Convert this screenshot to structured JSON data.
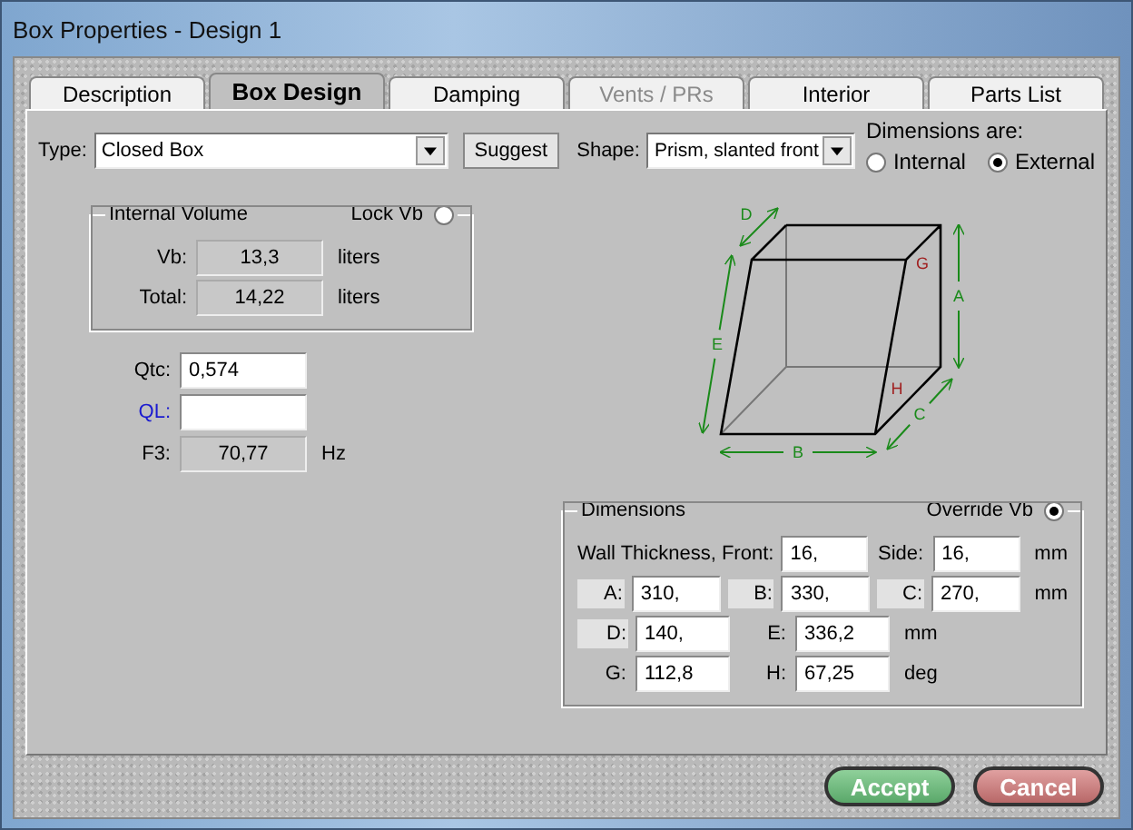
{
  "window": {
    "title": "Box Properties - Design 1"
  },
  "tabs": [
    {
      "label": "Description",
      "selected": false,
      "disabled": false
    },
    {
      "label": "Box Design",
      "selected": true,
      "disabled": false
    },
    {
      "label": "Damping",
      "selected": false,
      "disabled": false
    },
    {
      "label": "Vents / PRs",
      "selected": false,
      "disabled": true
    },
    {
      "label": "Interior",
      "selected": false,
      "disabled": false
    },
    {
      "label": "Parts List",
      "selected": false,
      "disabled": false
    }
  ],
  "type": {
    "label": "Type:",
    "value": "Closed Box"
  },
  "suggest_button": "Suggest",
  "shape": {
    "label": "Shape:",
    "value": "Prism, slanted front"
  },
  "dimensions_are": {
    "label": "Dimensions are:",
    "options": [
      {
        "label": "Internal",
        "selected": false
      },
      {
        "label": "External",
        "selected": true
      }
    ]
  },
  "internal_volume": {
    "title": "Internal Volume",
    "lock": {
      "label": "Lock Vb",
      "checked": false
    },
    "rows": [
      {
        "label": "Vb:",
        "value": "13,3",
        "unit": "liters"
      },
      {
        "label": "Total:",
        "value": "14,22",
        "unit": "liters"
      }
    ]
  },
  "response": [
    {
      "label": "Qtc:",
      "value": "0,574",
      "editable": true,
      "color": "#000000"
    },
    {
      "label": "QL:",
      "editable": true,
      "color": "#1a1ad0"
    },
    {
      "label": "F3:",
      "value": "70,77",
      "unit": "Hz",
      "editable": false,
      "color": "#000000"
    }
  ],
  "diagram": {
    "labels": [
      {
        "text": "D",
        "kind": "length"
      },
      {
        "text": "E",
        "kind": "length"
      },
      {
        "text": "A",
        "kind": "length"
      },
      {
        "text": "G",
        "kind": "angle"
      },
      {
        "text": "H",
        "kind": "angle"
      },
      {
        "text": "C",
        "kind": "length"
      },
      {
        "text": "B",
        "kind": "length"
      }
    ]
  },
  "dimensions": {
    "title": "Dimensions",
    "override": {
      "label": "Override Vb",
      "checked": true
    },
    "wall": {
      "label": "Wall Thickness, Front:",
      "front": "16,",
      "side_label": "Side:",
      "side": "16,",
      "unit": "mm"
    },
    "rows": [
      {
        "cells": [
          {
            "label": "A:",
            "value": "310,",
            "highlighted": true
          },
          {
            "label": "B:",
            "value": "330,",
            "highlighted": true
          },
          {
            "label": "C:",
            "value": "270,",
            "highlighted": true
          }
        ],
        "unit": "mm"
      },
      {
        "cells": [
          {
            "label": "D:",
            "value": "140,",
            "highlighted": true
          },
          {
            "label": "E:",
            "value": "336,2",
            "highlighted": false
          }
        ],
        "unit": "mm"
      },
      {
        "cells": [
          {
            "label": "G:",
            "value": "112,8",
            "highlighted": false
          },
          {
            "label": "H:",
            "value": "67,25",
            "highlighted": false
          }
        ],
        "unit": "deg"
      }
    ]
  },
  "buttons": [
    {
      "label": "Accept",
      "kind": "accept"
    },
    {
      "label": "Cancel",
      "kind": "cancel"
    }
  ]
}
